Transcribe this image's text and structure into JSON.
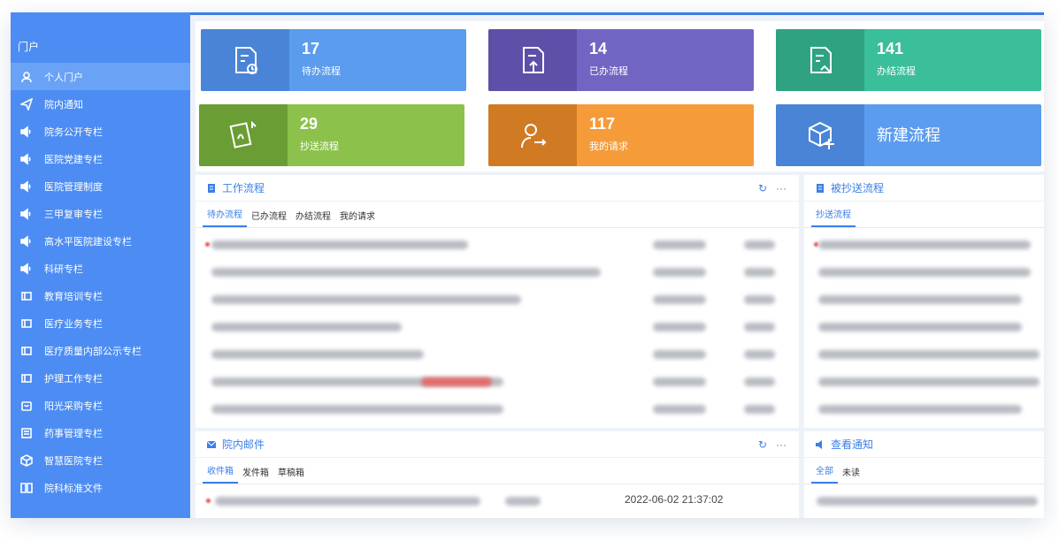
{
  "sidebar": {
    "section": "门户",
    "items": [
      {
        "label": "个人门户",
        "icon": "user-icon",
        "active": true
      },
      {
        "label": "院内通知",
        "icon": "send-icon"
      },
      {
        "label": "院务公开专栏",
        "icon": "speaker-icon"
      },
      {
        "label": "医院党建专栏",
        "icon": "speaker-icon"
      },
      {
        "label": "医院管理制度",
        "icon": "speaker-icon"
      },
      {
        "label": "三甲复审专栏",
        "icon": "speaker-icon"
      },
      {
        "label": "高水平医院建设专栏",
        "icon": "speaker-icon"
      },
      {
        "label": "科研专栏",
        "icon": "speaker-icon"
      },
      {
        "label": "教育培训专栏",
        "icon": "megaphone-icon"
      },
      {
        "label": "医疗业务专栏",
        "icon": "megaphone-icon"
      },
      {
        "label": "医疗质量内部公示专栏",
        "icon": "megaphone-icon"
      },
      {
        "label": "护理工作专栏",
        "icon": "megaphone-icon"
      },
      {
        "label": "阳光采购专栏",
        "icon": "bag-icon"
      },
      {
        "label": "药事管理专栏",
        "icon": "list-icon"
      },
      {
        "label": "智慧医院专栏",
        "icon": "cube-icon"
      },
      {
        "label": "院科标准文件",
        "icon": "book-icon"
      }
    ]
  },
  "stats": [
    {
      "num": "17",
      "label": "待办流程",
      "icon": "pending-doc-icon",
      "color": "#5c9cee",
      "icon_bg": "#4a84d6"
    },
    {
      "num": "14",
      "label": "已办流程",
      "icon": "done-doc-icon",
      "color": "#7165c4",
      "icon_bg": "#5e4fa8"
    },
    {
      "num": "141",
      "label": "办结流程",
      "icon": "finished-doc-icon",
      "color": "#3bbf9a",
      "icon_bg": "#2fa381"
    },
    {
      "num": "29",
      "label": "抄送流程",
      "icon": "cc-doc-icon",
      "color": "#8cc24c",
      "icon_bg": "#6b9d35"
    },
    {
      "num": "117",
      "label": "我的请求",
      "icon": "request-user-icon",
      "color": "#f59b3a",
      "icon_bg": "#d07a24"
    },
    {
      "big": "新建流程",
      "icon": "new-cube-icon",
      "color": "#5c9cee",
      "icon_bg": "#4a84d6"
    }
  ],
  "workflow": {
    "title": "工作流程",
    "tabs": [
      "待办流程",
      "已办流程",
      "办结流程",
      "我的请求"
    ]
  },
  "cc": {
    "title": "被抄送流程",
    "tabs": [
      "抄送流程"
    ]
  },
  "mail": {
    "title": "院内邮件",
    "tabs": [
      "收件箱",
      "发件箱",
      "草稿箱"
    ],
    "row_date": "2022-06-02 21:37:02"
  },
  "notice": {
    "title": "查看通知",
    "tabs": [
      "全部",
      "未读"
    ]
  }
}
